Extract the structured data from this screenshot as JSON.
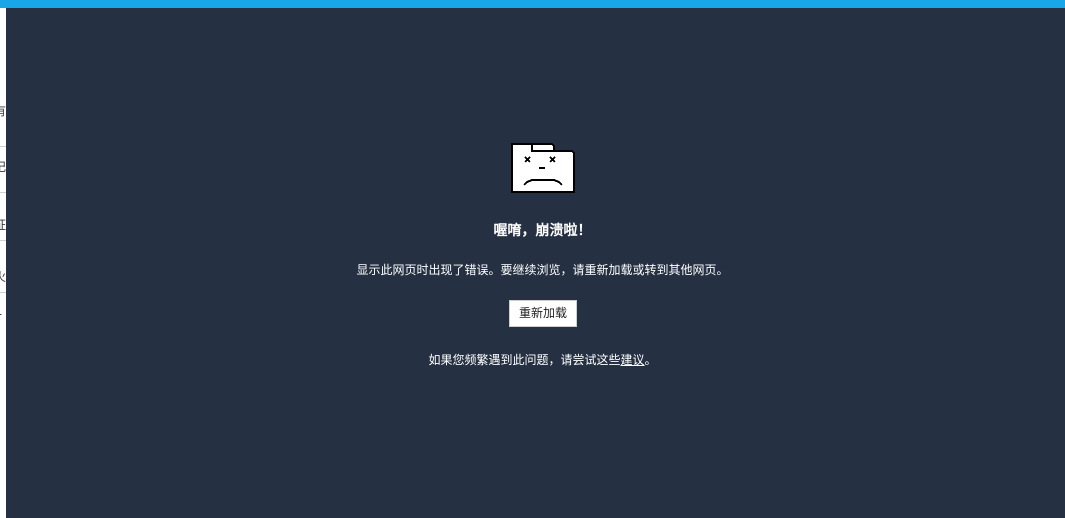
{
  "colors": {
    "top_bar": "#18a6e8",
    "panel_background": "#253142",
    "text": "#ffffff",
    "button_background": "#ffffff",
    "button_text": "#222222"
  },
  "left_strip": {
    "glyphs": [
      "有",
      "记",
      "证",
      "火",
      "T"
    ]
  },
  "crash": {
    "icon": "sad-tab-icon",
    "title": "喔唷，崩溃啦！",
    "message": "显示此网页时出现了错误。要继续浏览，请重新加载或转到其他网页。",
    "reload_label": "重新加载",
    "help_prefix": "如果您频繁遇到此问题，请尝试这些",
    "help_link": "建议",
    "help_suffix": "。"
  }
}
